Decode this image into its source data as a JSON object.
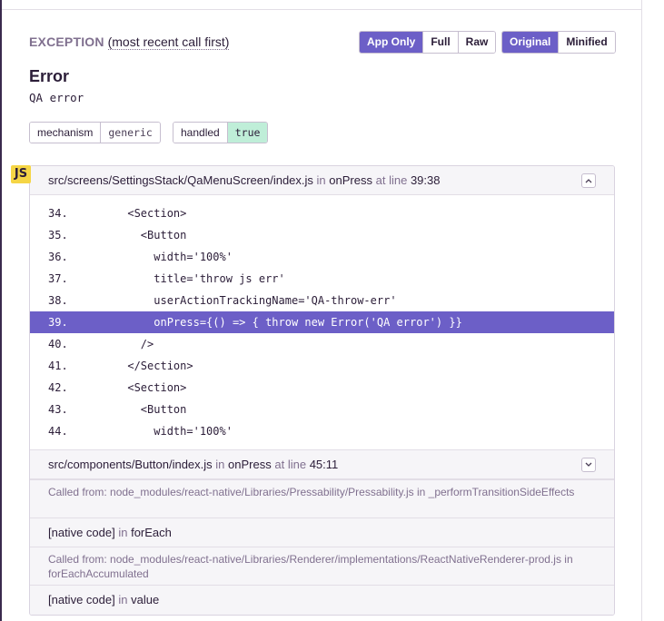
{
  "exception": {
    "label": "EXCEPTION",
    "sublabel": "(most recent call first)",
    "view_buttons": [
      "App Only",
      "Full",
      "Raw"
    ],
    "active_view": "App Only",
    "format_buttons": [
      "Original",
      "Minified"
    ],
    "active_format": "Original",
    "type": "Error",
    "value": "QA error",
    "tags": [
      {
        "key": "mechanism",
        "value": "generic"
      },
      {
        "key": "handled",
        "value": "true"
      }
    ],
    "platform_badge": "JS",
    "colors": {
      "accent": "#6c5fc7",
      "handled_true_bg": "#bfeed8",
      "js_badge": "#f5d545"
    }
  },
  "frames": [
    {
      "file": "src/screens/SettingsStack/QaMenuScreen/index.js",
      "in_text": "in",
      "function": "onPress",
      "at_line_text": "at line",
      "location": "39:38",
      "toggle_icon": "chevron-up-icon",
      "code": [
        {
          "ln": "34.",
          "src": "      <Section>"
        },
        {
          "ln": "35.",
          "src": "        <Button"
        },
        {
          "ln": "36.",
          "src": "          width='100%'"
        },
        {
          "ln": "37.",
          "src": "          title='throw js err'"
        },
        {
          "ln": "38.",
          "src": "          userActionTrackingName='QA-throw-err'"
        },
        {
          "ln": "39.",
          "src": "          onPress={() => { throw new Error('QA error') }}"
        },
        {
          "ln": "40.",
          "src": "        />"
        },
        {
          "ln": "41.",
          "src": "      </Section>"
        },
        {
          "ln": "42.",
          "src": "      <Section>"
        },
        {
          "ln": "43.",
          "src": "        <Button"
        },
        {
          "ln": "44.",
          "src": "          width='100%'"
        }
      ],
      "highlight_line": "39."
    },
    {
      "file": "src/components/Button/index.js",
      "in_text": "in",
      "function": "onPress",
      "at_line_text": "at line",
      "location": "45:11",
      "toggle_icon": "chevron-down-icon"
    }
  ],
  "rows": [
    {
      "kind": "called",
      "prefix": "Called from:",
      "path": "node_modules/react-native/Libraries/Pressability/Pressability.js",
      "in_text": "in",
      "function": "_performTransitionSideEffects"
    },
    {
      "kind": "native",
      "file": "[native code]",
      "in_text": "in",
      "function": "forEach"
    },
    {
      "kind": "called",
      "prefix": "Called from:",
      "path": "node_modules/react-native/Libraries/Renderer/implementations/ReactNativeRenderer-prod.js",
      "in_text": "in",
      "function": "forEachAccumulated"
    },
    {
      "kind": "native",
      "file": "[native code]",
      "in_text": "in",
      "function": "value"
    }
  ]
}
